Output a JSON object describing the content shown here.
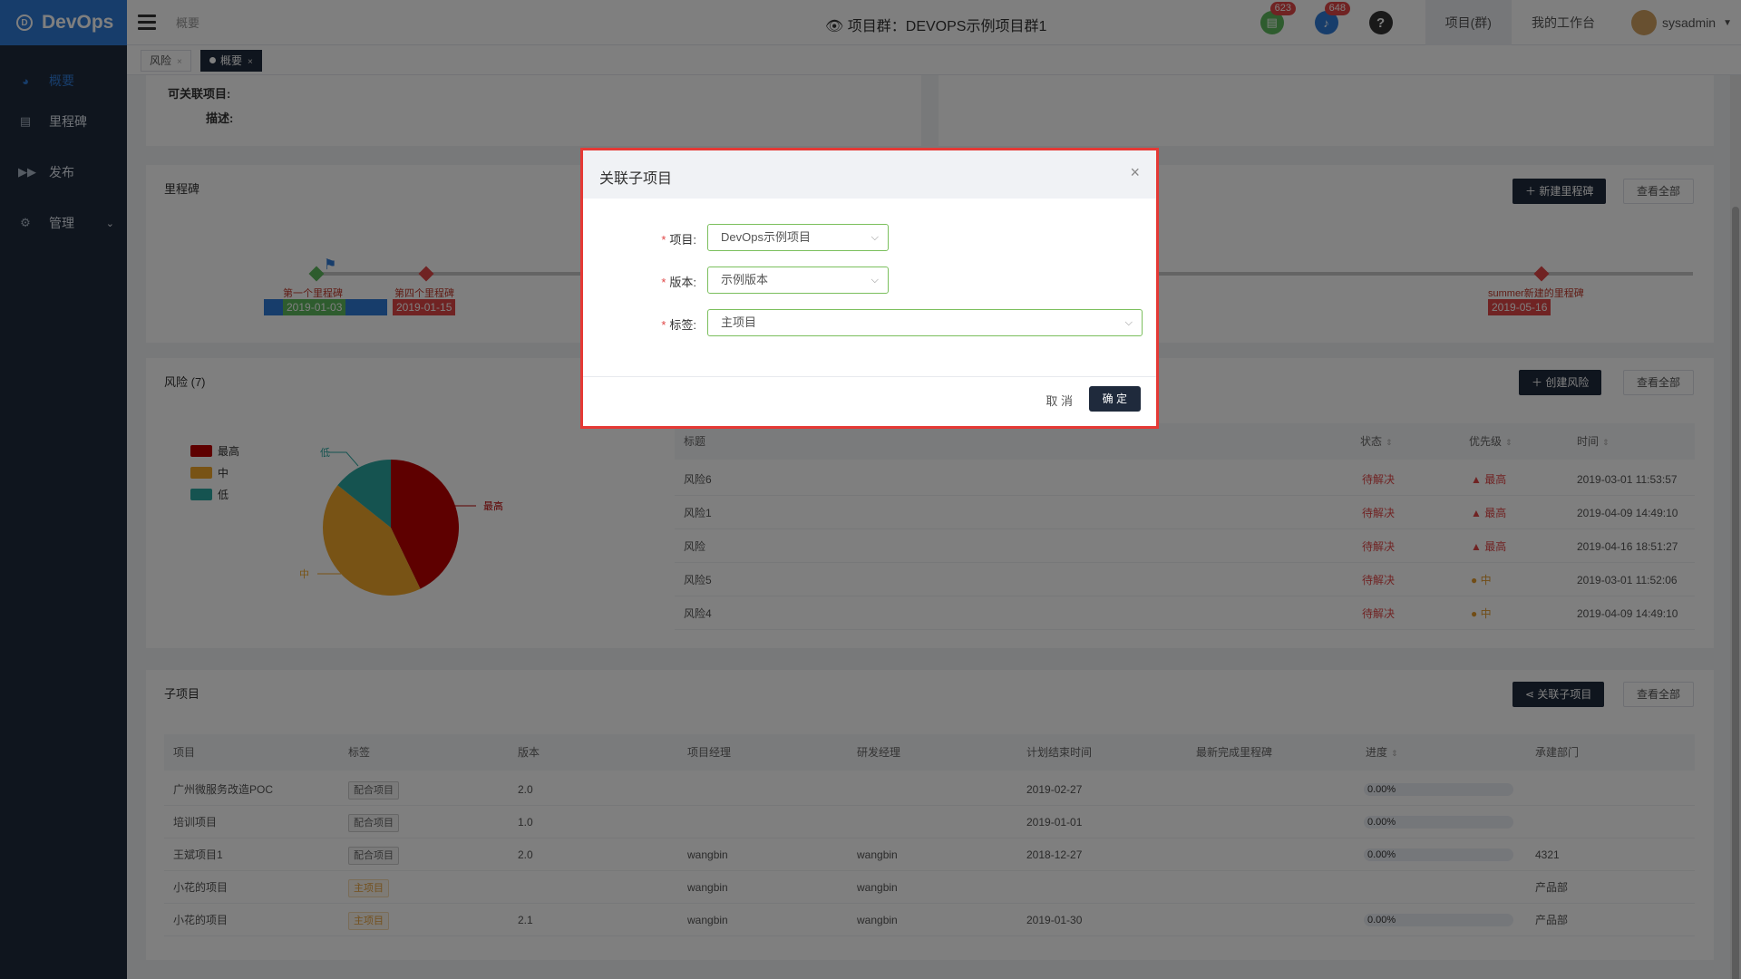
{
  "app": {
    "name": "DevOps"
  },
  "sidebar": {
    "items": [
      {
        "label": "概要",
        "icon": "dashboard-icon"
      },
      {
        "label": "里程碑",
        "icon": "calendar-icon"
      },
      {
        "label": "发布",
        "icon": "forward-icon"
      },
      {
        "label": "管理",
        "icon": "gear-icon"
      }
    ]
  },
  "topbar": {
    "breadcrumb": "概要",
    "title": "项目群：DEVOPS示例项目群1",
    "todo_count": "623",
    "notice_count": "648",
    "help": "?",
    "nav_project_group": "项目(群)",
    "nav_workspace": "我的工作台",
    "user": "sysadmin"
  },
  "tabs": [
    {
      "label": "风险"
    },
    {
      "label": "概要"
    }
  ],
  "info": {
    "related_label": "可关联项目:",
    "desc_label": "描述:"
  },
  "milestone": {
    "title": "里程碑",
    "new_button": "新建里程碑",
    "view_all": "查看全部",
    "points": [
      {
        "label": "第一个里程碑",
        "date": "2019-01-03"
      },
      {
        "label": "第四个里程碑",
        "date": "2019-01-15"
      },
      {
        "label": "summer新建的里程碑",
        "date": "2019-05-16"
      }
    ]
  },
  "risk": {
    "title": "风险 (7)",
    "create_button": "创建风险",
    "view_all": "查看全部",
    "legend": [
      "最高",
      "中",
      "低"
    ],
    "pie_labels": {
      "high": "最高",
      "mid": "中",
      "low": "低"
    },
    "columns": [
      "标题",
      "状态",
      "优先级",
      "时间"
    ],
    "rows": [
      {
        "title": "风险6",
        "status": "待解决",
        "priority": "最高",
        "time": "2019-03-01 11:53:57"
      },
      {
        "title": "风险1",
        "status": "待解决",
        "priority": "最高",
        "time": "2019-04-09 14:49:10"
      },
      {
        "title": "风险",
        "status": "待解决",
        "priority": "最高",
        "time": "2019-04-16 18:51:27"
      },
      {
        "title": "风险5",
        "status": "待解决",
        "priority": "中",
        "time": "2019-03-01 11:52:06"
      },
      {
        "title": "风险4",
        "status": "待解决",
        "priority": "中",
        "time": "2019-04-09 14:49:10"
      }
    ]
  },
  "chart_data": {
    "type": "pie",
    "title": "",
    "categories": [
      "最高",
      "中",
      "低"
    ],
    "values": [
      3,
      3,
      1
    ],
    "colors": [
      "#bd0000",
      "#f0a62a",
      "#2aa7a0"
    ]
  },
  "subprojects": {
    "title": "子项目",
    "link_button": "关联子项目",
    "view_all": "查看全部",
    "columns": [
      "项目",
      "标签",
      "版本",
      "项目经理",
      "研发经理",
      "计划结束时间",
      "最新完成里程碑",
      "进度",
      "承建部门"
    ],
    "rows": [
      {
        "name": "广州微服务改造POC",
        "tag": "配合项目",
        "main": false,
        "version": "2.0",
        "pm": "",
        "dm": "",
        "end": "2019-02-27",
        "ms": "",
        "progress": "0.00%",
        "dept": ""
      },
      {
        "name": "培训项目",
        "tag": "配合项目",
        "main": false,
        "version": "1.0",
        "pm": "",
        "dm": "",
        "end": "2019-01-01",
        "ms": "",
        "progress": "0.00%",
        "dept": ""
      },
      {
        "name": "王斌项目1",
        "tag": "配合项目",
        "main": false,
        "version": "2.0",
        "pm": "wangbin",
        "dm": "wangbin",
        "end": "2018-12-27",
        "ms": "",
        "progress": "0.00%",
        "dept": "4321"
      },
      {
        "name": "小花的项目",
        "tag": "主项目",
        "main": true,
        "version": "",
        "pm": "wangbin",
        "dm": "wangbin",
        "end": "",
        "ms": "",
        "progress": "",
        "dept": "产品部"
      },
      {
        "name": "小花的项目",
        "tag": "主项目",
        "main": true,
        "version": "2.1",
        "pm": "wangbin",
        "dm": "wangbin",
        "end": "2019-01-30",
        "ms": "",
        "progress": "0.00%",
        "dept": "产品部"
      }
    ]
  },
  "modal": {
    "title": "关联子项目",
    "close": "×",
    "required_mark": "*",
    "project_label": "项目:",
    "project_value": "DevOps示例项目",
    "version_label": "版本:",
    "version_value": "示例版本",
    "tag_label": "标签:",
    "tag_value": "主项目",
    "cancel": "取 消",
    "ok": "确 定"
  }
}
